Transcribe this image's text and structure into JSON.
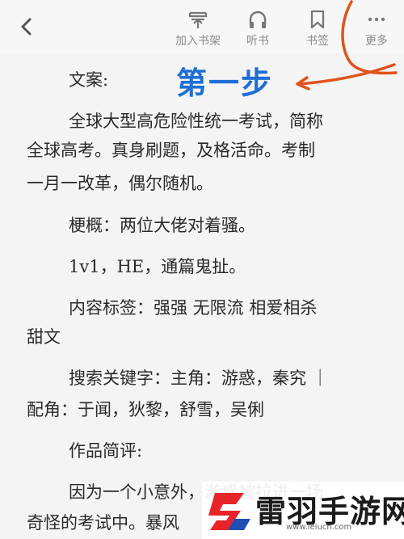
{
  "toolbar": {
    "back_icon": "chevron-left-icon",
    "items": [
      {
        "label": "加入书架",
        "icon": "add-bookshelf-icon"
      },
      {
        "label": "听书",
        "icon": "headphones-icon"
      },
      {
        "label": "书签",
        "icon": "bookmark-icon"
      },
      {
        "label": "更多",
        "icon": "more-dots-icon"
      }
    ]
  },
  "annotation": {
    "step_text": "第一步",
    "color_label": "#1f6fd6",
    "color_arrow": "#e0531c"
  },
  "book": {
    "lines": [
      "文案:",
      "全球大型高危险性统一考试，简称",
      "全球高考。真身刷题，及格活命。考制",
      "一月一改革，偶尔随机。",
      "梗概：两位大佬对着骚。",
      "1v1，HE，通篇鬼扯。",
      "内容标签：强强 无限流 相爱相杀",
      "甜文",
      "搜索关键字：主角：游惑，秦究 ｜",
      "配角：于闻，狄黎，舒雪，吴俐",
      "作品简评:",
      "因为一个小意外，游惑被拉进一场",
      "奇怪的考试中。暴风"
    ]
  },
  "watermark": {
    "name": "雷羽手游网",
    "url": "www.leiucn.com"
  }
}
